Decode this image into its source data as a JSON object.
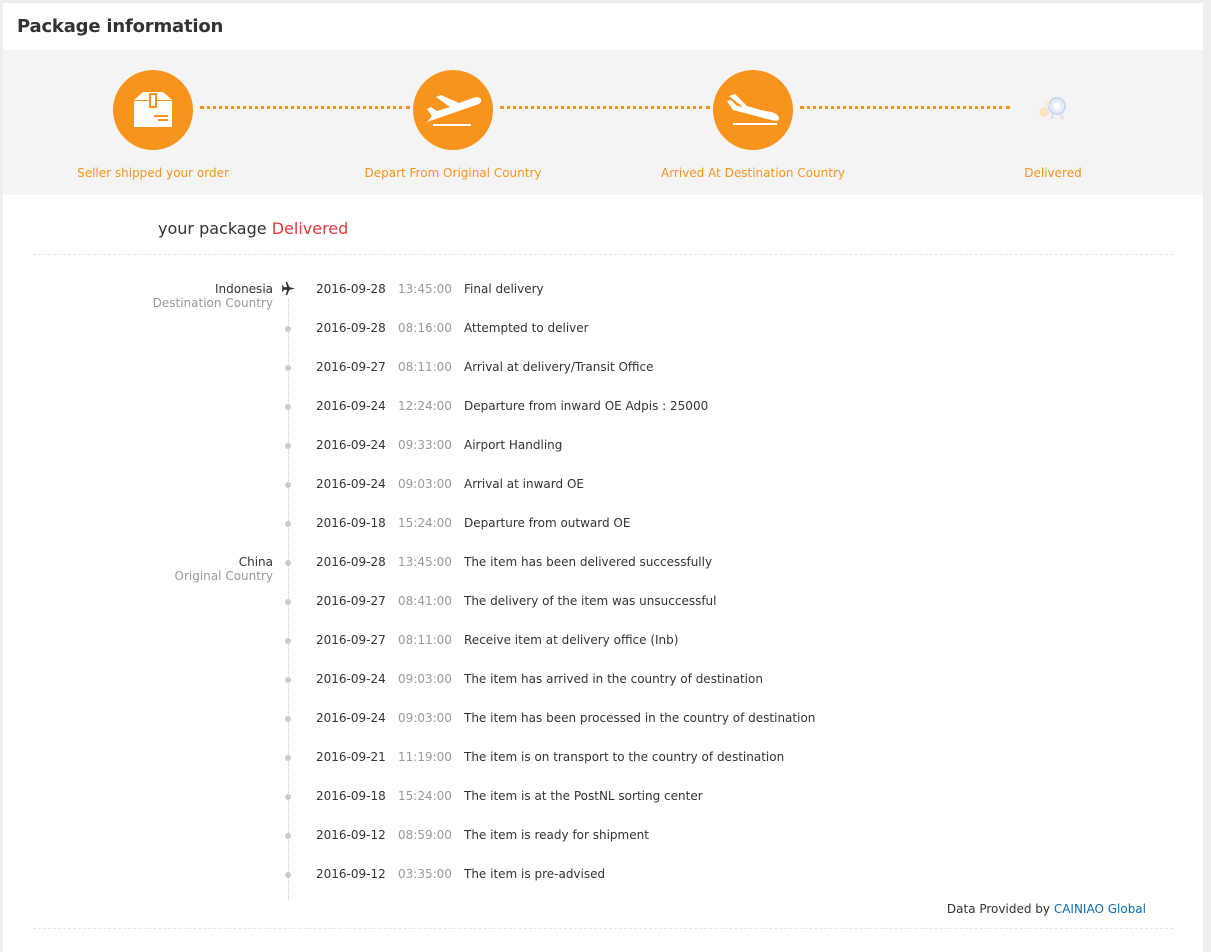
{
  "header": {
    "title": "Package information"
  },
  "colors": {
    "accent": "#f7941d",
    "status_highlight": "#e4393c",
    "link": "#0f6ab4"
  },
  "steps": [
    {
      "label": "Seller shipped your order",
      "icon": "package-box-icon",
      "done": true
    },
    {
      "label": "Depart From Original Country",
      "icon": "plane-takeoff-icon",
      "done": true
    },
    {
      "label": "Arrived At Destination Country",
      "icon": "plane-landing-icon",
      "done": true
    },
    {
      "label": "Delivered",
      "icon": "delivered-badge-icon",
      "done": false
    }
  ],
  "status": {
    "prefix": "your package",
    "value": "Delivered"
  },
  "countries": {
    "destination": {
      "name": "Indonesia",
      "sub": "Destination Country"
    },
    "origin": {
      "name": "China",
      "sub": "Original Country"
    }
  },
  "events": [
    {
      "date": "2016-09-28",
      "time": "13:45:00",
      "desc": "Final delivery"
    },
    {
      "date": "2016-09-28",
      "time": "08:16:00",
      "desc": "Attempted to deliver"
    },
    {
      "date": "2016-09-27",
      "time": "08:11:00",
      "desc": "Arrival at delivery/Transit Office"
    },
    {
      "date": "2016-09-24",
      "time": "12:24:00",
      "desc": "Departure from inward OE Adpis : 25000"
    },
    {
      "date": "2016-09-24",
      "time": "09:33:00",
      "desc": "Airport Handling"
    },
    {
      "date": "2016-09-24",
      "time": "09:03:00",
      "desc": "Arrival at inward OE"
    },
    {
      "date": "2016-09-18",
      "time": "15:24:00",
      "desc": "Departure from outward OE"
    },
    {
      "date": "2016-09-28",
      "time": "13:45:00",
      "desc": "The item has been delivered successfully"
    },
    {
      "date": "2016-09-27",
      "time": "08:41:00",
      "desc": "The delivery of the item was unsuccessful"
    },
    {
      "date": "2016-09-27",
      "time": "08:11:00",
      "desc": "Receive item at delivery office (Inb)"
    },
    {
      "date": "2016-09-24",
      "time": "09:03:00",
      "desc": "The item has arrived in the country of destination"
    },
    {
      "date": "2016-09-24",
      "time": "09:03:00",
      "desc": "The item has been processed in the country of destination"
    },
    {
      "date": "2016-09-21",
      "time": "11:19:00",
      "desc": "The item is on transport to the country of destination"
    },
    {
      "date": "2016-09-18",
      "time": "15:24:00",
      "desc": "The item is at the PostNL sorting center"
    },
    {
      "date": "2016-09-12",
      "time": "08:59:00",
      "desc": "The item is ready for shipment"
    },
    {
      "date": "2016-09-12",
      "time": "03:35:00",
      "desc": "The item is pre-advised"
    }
  ],
  "footer": {
    "prefix": "Data Provided by",
    "link": "CAINIAO Global"
  }
}
